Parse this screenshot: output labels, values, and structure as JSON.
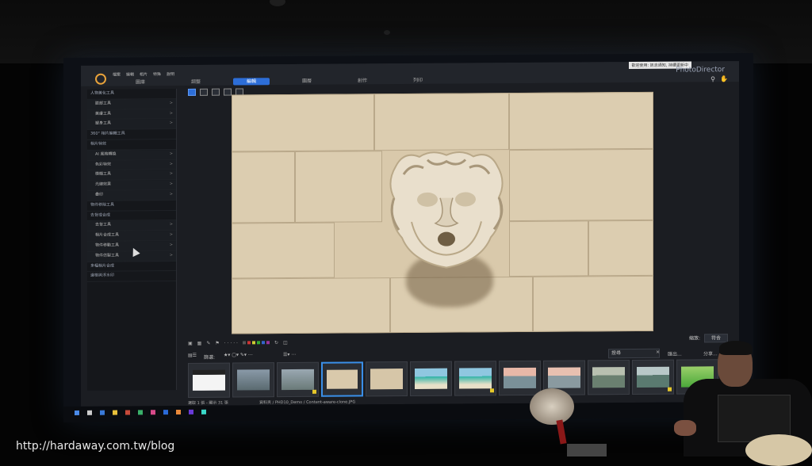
{
  "app": {
    "brand": "PhotoDirector",
    "notice": "歡迎使用: 訊息通知, 持續更新中",
    "menu": [
      "檔案",
      "編輯",
      "相片",
      "特殊",
      "說明"
    ],
    "modes": [
      "圖庫",
      "調整",
      "編輯",
      "圖層",
      "創作",
      "列印"
    ],
    "active_mode": "編輯"
  },
  "sidebar": {
    "items": [
      {
        "label": "人物美化工具",
        "kind": "header"
      },
      {
        "label": "臉部工具",
        "kind": "child"
      },
      {
        "label": "美膚工具",
        "kind": "child"
      },
      {
        "label": "塑身工具",
        "kind": "child"
      },
      {
        "label": "360° 相片編輯工具",
        "kind": "header"
      },
      {
        "label": "相片特效",
        "kind": "header"
      },
      {
        "label": "AI 風格轉換",
        "kind": "child"
      },
      {
        "label": "色彩特效",
        "kind": "child"
      },
      {
        "label": "模糊工具",
        "kind": "child"
      },
      {
        "label": "光線效果",
        "kind": "child"
      },
      {
        "label": "疊印",
        "kind": "child"
      },
      {
        "label": "物件移除工具",
        "kind": "header"
      },
      {
        "label": "去背或合成",
        "kind": "header"
      },
      {
        "label": "去背工具",
        "kind": "child"
      },
      {
        "label": "相片合成工具",
        "kind": "child"
      },
      {
        "label": "物件移動工具",
        "kind": "child"
      },
      {
        "label": "物件仿製工具",
        "kind": "child"
      },
      {
        "label": "多幅相片合成",
        "kind": "header"
      },
      {
        "label": "邊框與浮水印",
        "kind": "header"
      }
    ]
  },
  "filmstrip_toolbar": {
    "filter_label": "篩選:",
    "search_placeholder": "搜尋",
    "export_label": "匯出...",
    "share_label": "分享..."
  },
  "viewer_toolbar": {
    "zoom_label": "縮放:",
    "zoom_value": "符合"
  },
  "status": {
    "selection": "選取 1 張 - 顯示 31 張",
    "path": "資料夾 / PHD10_Demo / Content-aware-clone.JPG"
  },
  "colors": {
    "accent": "#2d6ed8",
    "selected_border": "#3a8fe8",
    "flag": "#e6c82a"
  },
  "watermark": "http://hardaway.com.tw/blog"
}
